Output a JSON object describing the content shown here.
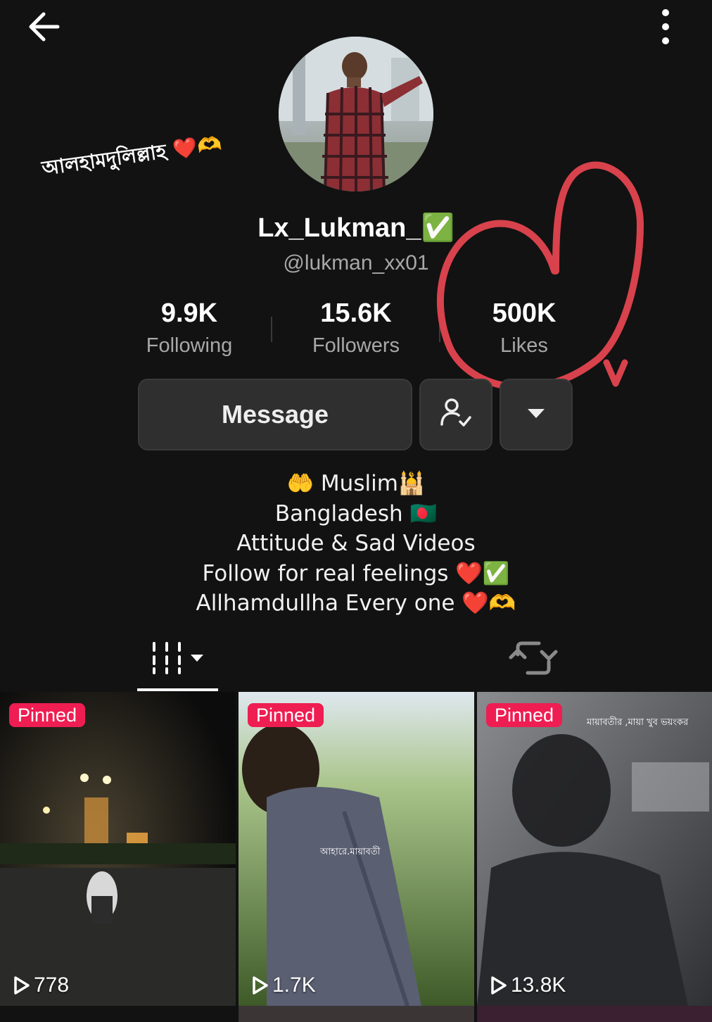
{
  "profile": {
    "display_name": "Lx_Lukman_✅",
    "handle": "@lukman_xx01",
    "caption_bangla": "আলহামদুলিল্লাহ ❤️🫶",
    "stats": [
      {
        "value": "9.9K",
        "label": "Following"
      },
      {
        "value": "15.6K",
        "label": "Followers"
      },
      {
        "value": "500K",
        "label": "Likes"
      }
    ]
  },
  "actions": {
    "message_label": "Message"
  },
  "bio": [
    "🤲 Muslim🕌",
    "Bangladesh 🇧🇩",
    "Attitude & Sad Videos",
    "Follow for real feelings ❤️✅",
    "Allhamdullha Every one ❤️🫶"
  ],
  "videos": [
    {
      "badge": "Pinned",
      "views": "778",
      "caption": ""
    },
    {
      "badge": "Pinned",
      "views": "1.7K",
      "caption": "আহারে.মায়াবতী"
    },
    {
      "badge": "Pinned",
      "views": "13.8K",
      "caption": "মায়াবতীর ,মায়া খুব ভয়ংকর"
    }
  ],
  "colors": {
    "background": "#121212",
    "pinned_badge": "#ee1d52",
    "annotation_heart": "#d8424c"
  }
}
